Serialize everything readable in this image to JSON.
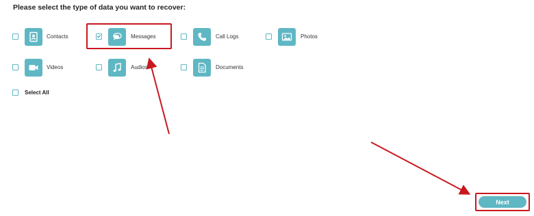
{
  "heading": "Please select the type of data you want to recover:",
  "options": [
    {
      "label": "Contacts",
      "checked": false,
      "icon": "contacts-icon"
    },
    {
      "label": "Messages",
      "checked": true,
      "icon": "messages-icon"
    },
    {
      "label": "Call Logs",
      "checked": false,
      "icon": "phone-icon"
    },
    {
      "label": "Photos",
      "checked": false,
      "icon": "photo-icon"
    },
    {
      "label": "Videos",
      "checked": false,
      "icon": "video-icon"
    },
    {
      "label": "Audios",
      "checked": false,
      "icon": "music-icon"
    },
    {
      "label": "Documents",
      "checked": false,
      "icon": "document-icon"
    }
  ],
  "select_all": {
    "label": "Select All",
    "checked": false
  },
  "next_button": {
    "label": "Next"
  },
  "colors": {
    "accent": "#5fb7c4",
    "annotation": "#c8171e"
  }
}
